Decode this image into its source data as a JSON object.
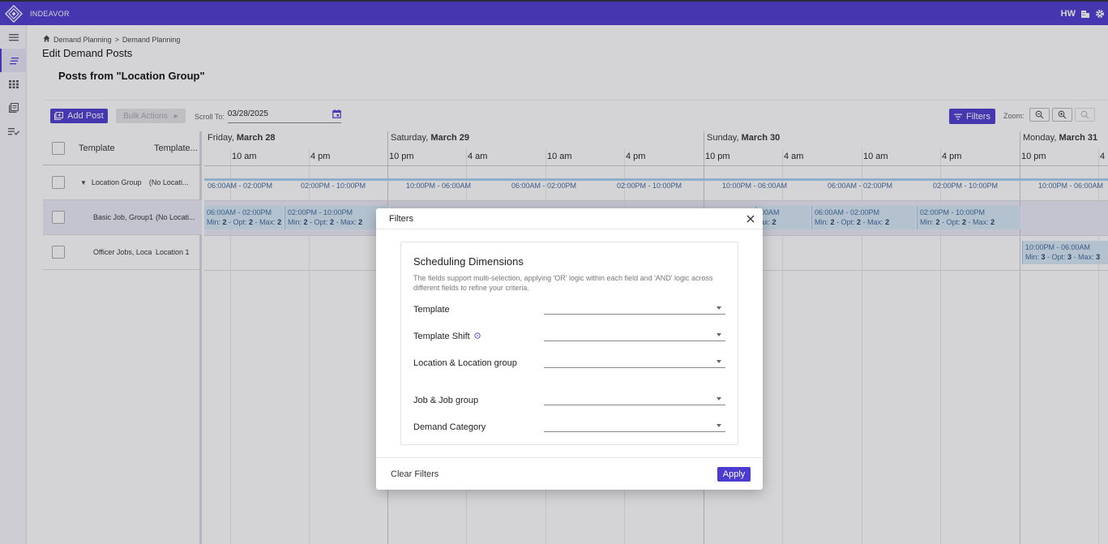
{
  "app": {
    "brand": "INDEAVOR",
    "user_initials": "HW"
  },
  "breadcrumb": {
    "items": [
      "Demand Planning",
      "Demand Planning"
    ],
    "separator": ">"
  },
  "page": {
    "title": "Edit Demand Posts",
    "section_title": "Posts from \"Location Group\""
  },
  "toolbar": {
    "add_post_label": "Add Post",
    "bulk_actions_label": "Bulk Actions",
    "scroll_to_label": "Scroll To:",
    "scroll_to_value": "03/28/2025",
    "filters_label": "Filters",
    "zoom_label": "Zoom:"
  },
  "grid": {
    "columns": [
      "Template",
      "Template..."
    ],
    "rows": [
      {
        "template": "Location Group",
        "template_shift": "(No Locati..."
      },
      {
        "template": "Basic Job, Group1",
        "template_shift": "(No Locati..."
      },
      {
        "template": "Officer Jobs, Loca",
        "template_shift": "Location 1"
      }
    ]
  },
  "timeline": {
    "days": [
      {
        "prefix": "Friday, ",
        "bold": "March 28"
      },
      {
        "prefix": "Saturday, ",
        "bold": "March 29"
      },
      {
        "prefix": "Sunday, ",
        "bold": "March 30"
      },
      {
        "prefix": "Monday, ",
        "bold": "March 31"
      }
    ],
    "hours": [
      "10 am",
      "4 pm",
      "10 pm",
      "4 am",
      "10 am",
      "4 pm",
      "10 pm",
      "4 am",
      "10 am",
      "4 pm",
      "10 pm",
      "4"
    ],
    "group_segments": [
      "06:00AM - 02:00PM",
      "02:00PM - 10:00PM",
      "10:00PM - 06:00AM",
      "06:00AM - 02:00PM",
      "02:00PM - 10:00PM",
      "10:00PM - 06:00AM",
      "06:00AM - 02:00PM",
      "02:00PM - 10:00PM",
      "10:00PM - 06:00AM"
    ],
    "row1_shifts": [
      {
        "time": "06:00AM - 02:00PM",
        "min": "2",
        "opt": "2",
        "max": "2"
      },
      {
        "time": "02:00PM - 10:00PM",
        "min": "2",
        "opt": "2",
        "max": "2"
      },
      {
        "time": "00AM",
        "min": "",
        "opt": "",
        "max": "2"
      },
      {
        "time": "06:00AM - 02:00PM",
        "min": "2",
        "opt": "2",
        "max": "2"
      },
      {
        "time": "02:00PM - 10:00PM",
        "min": "2",
        "opt": "2",
        "max": "2"
      }
    ],
    "row2_shifts": [
      {
        "time": "10:00PM - 06:00AM",
        "min": "3",
        "opt": "3",
        "max": "3"
      }
    ],
    "labels": {
      "min": "Min: ",
      "opt": " - Opt: ",
      "max": " - Max: "
    }
  },
  "modal": {
    "title": "Filters",
    "card_title": "Scheduling Dimensions",
    "description": "The fields support multi-selection, applying 'OR' logic within each field and 'AND' logic across different fields to refine your criteria.",
    "fields": [
      "Template",
      "Template Shift",
      "Location & Location group",
      "Job & Job group",
      "Demand Category"
    ],
    "clear_label": "Clear Filters",
    "apply_label": "Apply"
  },
  "colors": {
    "brand": "#4b3bcf",
    "shift_bg": "#d8e9f8"
  }
}
